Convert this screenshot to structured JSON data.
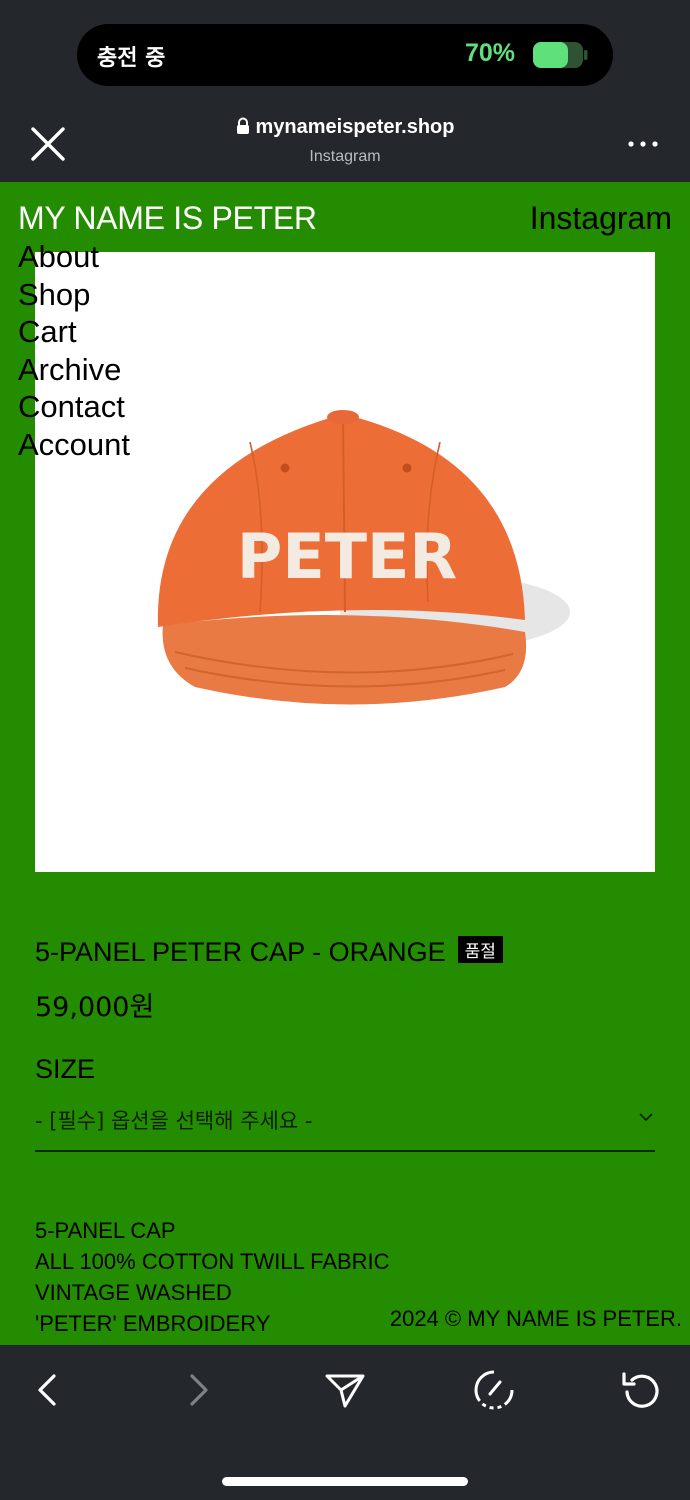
{
  "status_bar": {
    "charging_text": "충전 중",
    "battery_percent": "70%",
    "battery_level": 0.7,
    "battery_color": "#5fe07a"
  },
  "browser": {
    "url": "mynameispeter.shop",
    "source_app": "Instagram",
    "close_icon": "close-icon",
    "more_icon": "more-dots-icon"
  },
  "site": {
    "title": "MY NAME IS PETER",
    "instagram_link": "Instagram",
    "background_color": "#248c00",
    "nav": [
      "About",
      "Shop",
      "Cart",
      "Archive",
      "Contact",
      "Account"
    ]
  },
  "product": {
    "name": "5-PANEL PETER CAP - ORANGE",
    "badge": "품절",
    "price": "59,000원",
    "cap_text": "PETER",
    "size_label": "SIZE",
    "size_placeholder": "- [필수] 옵션을 선택해 주세요 -",
    "description": [
      "5-PANEL CAP",
      "ALL 100% COTTON TWILL FABRIC",
      "VINTAGE WASHED",
      "'PETER' EMBROIDERY"
    ]
  },
  "footer": {
    "copyright": "2024 © MY NAME IS PETER."
  },
  "toolbar": {
    "icons": [
      "back-icon",
      "forward-icon",
      "share-icon",
      "browser-icon",
      "reload-icon"
    ]
  }
}
